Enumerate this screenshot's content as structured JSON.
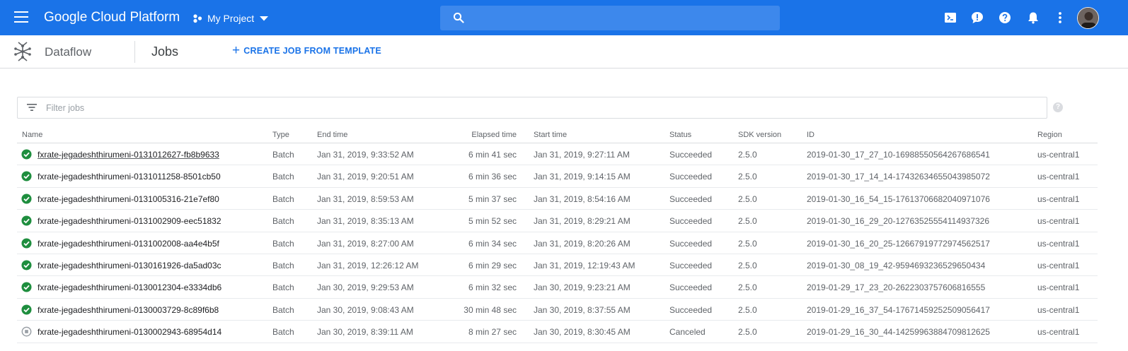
{
  "topbar": {
    "brand": "Google Cloud Platform",
    "project_name": "My Project",
    "search_placeholder": ""
  },
  "subheader": {
    "product": "Dataflow",
    "page_title": "Jobs",
    "create_label": "CREATE JOB FROM TEMPLATE"
  },
  "filter": {
    "placeholder": "Filter jobs"
  },
  "table": {
    "headers": {
      "name": "Name",
      "type": "Type",
      "end_time": "End time",
      "elapsed": "Elapsed time",
      "start_time": "Start time",
      "status": "Status",
      "sdk": "SDK version",
      "id": "ID",
      "region": "Region"
    },
    "rows": [
      {
        "name": "fxrate-jegadeshthirumeni-0131012627-fb8b9633",
        "type": "Batch",
        "end": "Jan 31, 2019, 9:33:52 AM",
        "elapsed": "6 min 41 sec",
        "start": "Jan 31, 2019, 9:27:11 AM",
        "status": "Succeeded",
        "sdk": "2.5.0",
        "id": "2019-01-30_17_27_10-16988550564267686541",
        "region": "us-central1"
      },
      {
        "name": "fxrate-jegadeshthirumeni-0131011258-8501cb50",
        "type": "Batch",
        "end": "Jan 31, 2019, 9:20:51 AM",
        "elapsed": "6 min 36 sec",
        "start": "Jan 31, 2019, 9:14:15 AM",
        "status": "Succeeded",
        "sdk": "2.5.0",
        "id": "2019-01-30_17_14_14-17432634655043985072",
        "region": "us-central1"
      },
      {
        "name": "fxrate-jegadeshthirumeni-0131005316-21e7ef80",
        "type": "Batch",
        "end": "Jan 31, 2019, 8:59:53 AM",
        "elapsed": "5 min 37 sec",
        "start": "Jan 31, 2019, 8:54:16 AM",
        "status": "Succeeded",
        "sdk": "2.5.0",
        "id": "2019-01-30_16_54_15-17613706682040971076",
        "region": "us-central1"
      },
      {
        "name": "fxrate-jegadeshthirumeni-0131002909-eec51832",
        "type": "Batch",
        "end": "Jan 31, 2019, 8:35:13 AM",
        "elapsed": "5 min 52 sec",
        "start": "Jan 31, 2019, 8:29:21 AM",
        "status": "Succeeded",
        "sdk": "2.5.0",
        "id": "2019-01-30_16_29_20-12763525554114937326",
        "region": "us-central1"
      },
      {
        "name": "fxrate-jegadeshthirumeni-0131002008-aa4e4b5f",
        "type": "Batch",
        "end": "Jan 31, 2019, 8:27:00 AM",
        "elapsed": "6 min 34 sec",
        "start": "Jan 31, 2019, 8:20:26 AM",
        "status": "Succeeded",
        "sdk": "2.5.0",
        "id": "2019-01-30_16_20_25-12667919772974562517",
        "region": "us-central1"
      },
      {
        "name": "fxrate-jegadeshthirumeni-0130161926-da5ad03c",
        "type": "Batch",
        "end": "Jan 31, 2019, 12:26:12 AM",
        "elapsed": "6 min 29 sec",
        "start": "Jan 31, 2019, 12:19:43 AM",
        "status": "Succeeded",
        "sdk": "2.5.0",
        "id": "2019-01-30_08_19_42-9594693236529650434",
        "region": "us-central1"
      },
      {
        "name": "fxrate-jegadeshthirumeni-0130012304-e3334db6",
        "type": "Batch",
        "end": "Jan 30, 2019, 9:29:53 AM",
        "elapsed": "6 min 32 sec",
        "start": "Jan 30, 2019, 9:23:21 AM",
        "status": "Succeeded",
        "sdk": "2.5.0",
        "id": "2019-01-29_17_23_20-2622303757606816555",
        "region": "us-central1"
      },
      {
        "name": "fxrate-jegadeshthirumeni-0130003729-8c89f6b8",
        "type": "Batch",
        "end": "Jan 30, 2019, 9:08:43 AM",
        "elapsed": "30 min 48 sec",
        "start": "Jan 30, 2019, 8:37:55 AM",
        "status": "Succeeded",
        "sdk": "2.5.0",
        "id": "2019-01-29_16_37_54-17671459252509056417",
        "region": "us-central1"
      },
      {
        "name": "fxrate-jegadeshthirumeni-0130002943-68954d14",
        "type": "Batch",
        "end": "Jan 30, 2019, 8:39:11 AM",
        "elapsed": "8 min 27 sec",
        "start": "Jan 30, 2019, 8:30:45 AM",
        "status": "Canceled",
        "sdk": "2.5.0",
        "id": "2019-01-29_16_30_44-14259963884709812625",
        "region": "us-central1"
      }
    ]
  },
  "colors": {
    "brand_blue": "#1a73e8",
    "success_green": "#1e8e3e",
    "canceled_grey": "#9aa0a6"
  },
  "icons": {
    "succeeded": "check-circle-icon",
    "canceled": "stop-circle-icon"
  }
}
